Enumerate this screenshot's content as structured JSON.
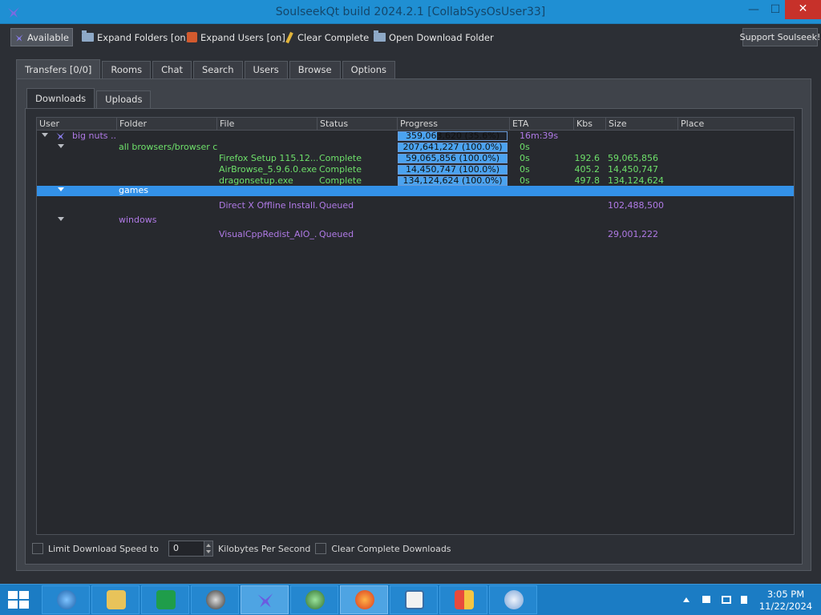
{
  "window": {
    "title": "SoulseekQt build 2024.2.1 [CollabSysOsUser33]",
    "min_glyph": "—",
    "max_glyph": "☐",
    "close_glyph": "✕"
  },
  "toolbar": {
    "available_label": "Available",
    "expand_folders_label": "Expand Folders [on]",
    "expand_users_label": "Expand Users [on]",
    "clear_complete_label": "Clear Complete",
    "open_download_folder_label": "Open Download Folder",
    "support_label": "Support Soulseek!"
  },
  "tabs": {
    "main": [
      "Transfers [0/0]",
      "Rooms",
      "Chat",
      "Search",
      "Users",
      "Browse",
      "Options"
    ],
    "sub": [
      "Downloads",
      "Uploads"
    ]
  },
  "table": {
    "columns": [
      "User",
      "Folder",
      "File",
      "Status",
      "Progress",
      "ETA",
      "Kbs",
      "Size",
      "Place"
    ],
    "rows": [
      {
        "user": "big nuts ...",
        "folder": "",
        "file": "",
        "status": "",
        "progress_text": "359,063,620 (35.6%)",
        "progress_fraction": 0.356,
        "eta": "16m:39s",
        "kbs": "",
        "size": "",
        "place": ""
      },
      {
        "user": "",
        "folder": "all browsers/browser c...",
        "file": "",
        "status": "",
        "progress_text": "207,641,227 (100.0%)",
        "progress_fraction": 1.0,
        "eta": "0s",
        "kbs": "",
        "size": "",
        "place": ""
      },
      {
        "user": "",
        "folder": "",
        "file": "Firefox Setup 115.12....",
        "status": "Complete",
        "progress_text": "59,065,856 (100.0%)",
        "progress_fraction": 1.0,
        "eta": "0s",
        "kbs": "192.6",
        "size": "59,065,856",
        "place": ""
      },
      {
        "user": "",
        "folder": "",
        "file": "AirBrowse_5.9.6.0.exe",
        "status": "Complete",
        "progress_text": "14,450,747 (100.0%)",
        "progress_fraction": 1.0,
        "eta": "0s",
        "kbs": "405.2",
        "size": "14,450,747",
        "place": ""
      },
      {
        "user": "",
        "folder": "",
        "file": "dragonsetup.exe",
        "status": "Complete",
        "progress_text": "134,124,624 (100.0%)",
        "progress_fraction": 1.0,
        "eta": "0s",
        "kbs": "497.8",
        "size": "134,124,624",
        "place": ""
      },
      {
        "user": "",
        "folder": "games",
        "file": "",
        "status": "",
        "progress_text": "",
        "eta": "",
        "kbs": "",
        "size": "",
        "place": ""
      },
      {
        "user": "",
        "folder": "",
        "file": "Direct X Offline Install...",
        "status": "Queued",
        "progress_text": "",
        "eta": "",
        "kbs": "",
        "size": "102,488,500",
        "place": ""
      },
      {
        "user": "",
        "folder": "windows",
        "file": "",
        "status": "",
        "progress_text": "",
        "eta": "",
        "kbs": "",
        "size": "",
        "place": ""
      },
      {
        "user": "",
        "folder": "",
        "file": "VisualCppRedist_AIO_...",
        "status": "Queued",
        "progress_text": "",
        "eta": "",
        "kbs": "",
        "size": "29,001,222",
        "place": ""
      }
    ]
  },
  "bottom": {
    "limit_label": "Limit Download Speed to",
    "speed_value": "0",
    "unit_label": "Kilobytes Per Second",
    "clear_label": "Clear Complete Downloads"
  },
  "taskbar": {
    "time": "3:05 PM",
    "date": "11/22/2024"
  },
  "colors": {
    "complete": "#6ee06a",
    "queued": "#b07ae6",
    "selection": "#3391e8",
    "progress_fill": "#4ba3f0"
  }
}
